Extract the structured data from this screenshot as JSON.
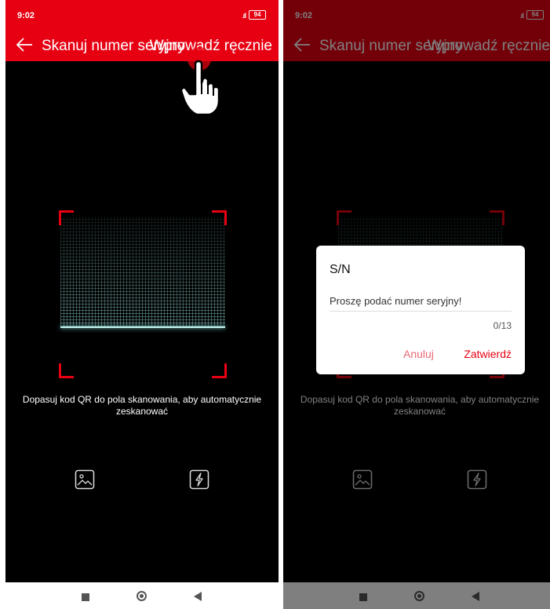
{
  "status": {
    "time": "9:02",
    "signal": ".ıll",
    "battery": "94"
  },
  "appbar": {
    "title": "Skanuj numer seryjny",
    "action_label": "Wprowadź ręcznie"
  },
  "scanner": {
    "hint": "Dopasuj kod QR do pola skanowania, aby automatycznie zeskanować"
  },
  "icons": {
    "gallery": "gallery-icon",
    "flash": "flash-icon",
    "back": "back-arrow-icon"
  },
  "dialog": {
    "title": "S/N",
    "placeholder": "Proszę podać numer seryjny!",
    "counter": "0/13",
    "cancel_label": "Anuluj",
    "confirm_label": "Zatwierdź"
  },
  "colors": {
    "accent": "#e60012",
    "cancel": "#e86a75"
  }
}
